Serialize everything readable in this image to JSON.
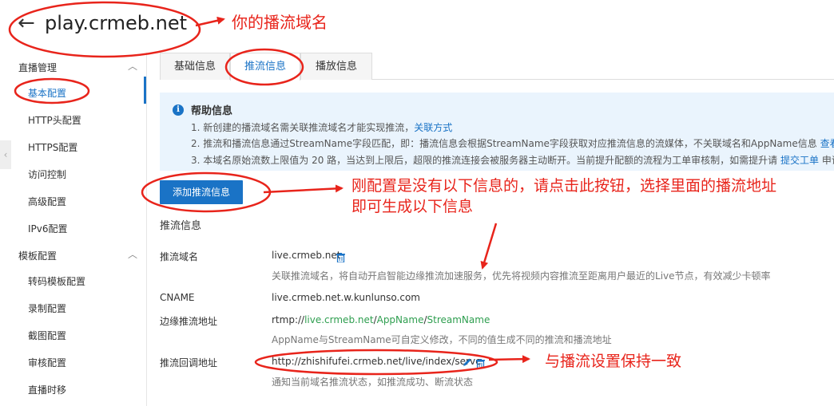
{
  "header": {
    "back_icon": "←",
    "domain": "play.crmeb.net"
  },
  "sidebar": {
    "groups": [
      {
        "label": "直播管理",
        "items": [
          "基本配置",
          "HTTP头配置",
          "HTTPS配置",
          "访问控制",
          "高级配置",
          "IPv6配置"
        ]
      },
      {
        "label": "模板配置",
        "items": [
          "转码模板配置",
          "录制配置",
          "截图配置",
          "审核配置",
          "直播时移"
        ]
      }
    ],
    "active_item": "基本配置"
  },
  "tabs": [
    "基础信息",
    "推流信息",
    "播放信息"
  ],
  "active_tab": "推流信息",
  "help": {
    "title": "帮助信息",
    "line1_text": "1. 新创建的播流域名需关联推流域名才能实现推流，",
    "line1_link": "关联方式",
    "line2_text": "2. 推流和播流信息通过StreamName字段匹配，即：播流信息会根据StreamName字段获取对应推流信息的流媒体，不关联域名和AppName信息 ",
    "line2_link": "查看示例",
    "line3_text": "3. 本域名原始流数上限值为 20 路，当达到上限后，超限的推流连接会被服务器主动断开。当前提升配额的流程为工单审核制，如需提升请 ",
    "line3_link": "提交工单",
    "line3_tail": " 申请"
  },
  "add_button": "添加推流信息",
  "section_title": "推流信息",
  "rows": {
    "push_domain": {
      "label": "推流域名",
      "value": "live.crmeb.net",
      "desc": "关联推流域名，将自动开启智能边缘推流加速服务，优先将视频内容推流至距离用户最近的Live节点，有效减少卡顿率"
    },
    "cname": {
      "label": "CNAME",
      "value": "live.crmeb.net.w.kunlunso.com"
    },
    "edge": {
      "label": "边缘推流地址",
      "prefix": "rtmp://",
      "host": "live.crmeb.net",
      "sep1": "/",
      "app": "AppName",
      "sep2": "/",
      "stream": "StreamName",
      "desc": "AppName与StreamName可自定义修改，不同的值生成不同的推流和播流地址"
    },
    "callback": {
      "label": "推流回调地址",
      "value": "http://zhishifufei.crmeb.net/live/index/serve",
      "desc": "通知当前域名推流状态，如推流成功、断流状态"
    }
  },
  "annotations": {
    "domain_note": "你的播流域名",
    "button_note_1": "刚配置是没有以下信息的，请点击此按钮，选择里面的播流地址",
    "button_note_2": "即可生成以下信息",
    "callback_note": "与播流设置保持一致"
  },
  "colors": {
    "accent": "#1a73c6",
    "annotation": "#e8241b",
    "help_bg": "#eaf4fd",
    "green": "#2e9e4f"
  }
}
